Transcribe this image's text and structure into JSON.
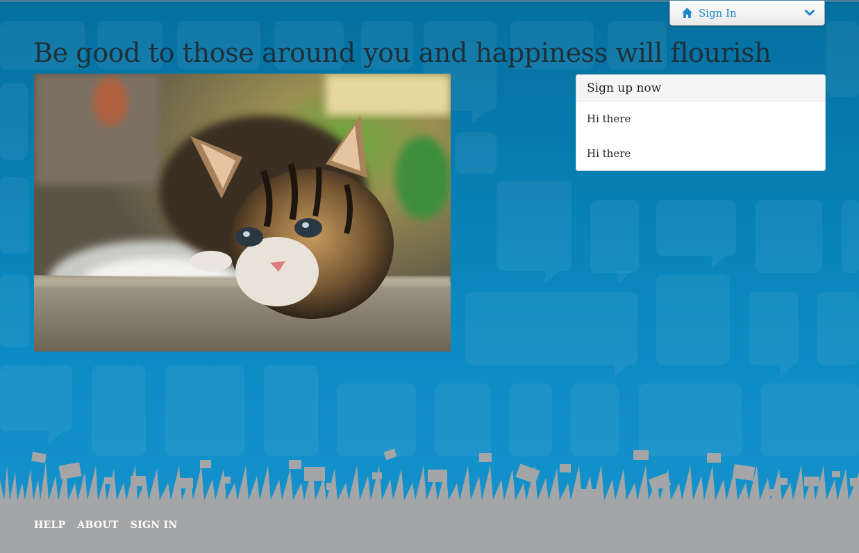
{
  "header": {
    "signin_menu": {
      "label": "Sign In",
      "icon": "home-icon",
      "caret_icon": "chevron-down-icon"
    }
  },
  "main": {
    "heading": "Be good to those around you and happiness will flourish",
    "photo": {
      "alt_subject": "kitten-photo"
    }
  },
  "signup_panel": {
    "title": "Sign up now",
    "items": [
      "Hi there",
      "Hi there"
    ]
  },
  "footer": {
    "links": [
      "HELP",
      "ABOUT",
      "SIGN IN"
    ]
  },
  "colors": {
    "background": "#0a88c0",
    "accent": "#1b85c4",
    "footer": "#a3a5a6"
  }
}
